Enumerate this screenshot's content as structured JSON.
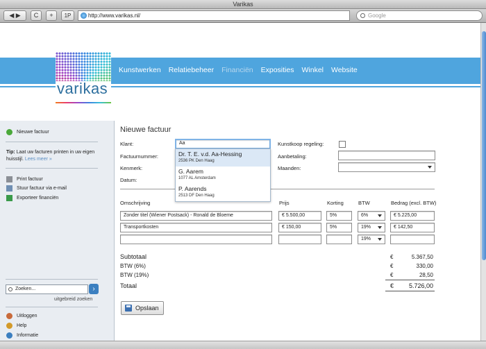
{
  "window": {
    "title": "Varikas"
  },
  "browser": {
    "url": "http://www.varikas.nl/",
    "search_placeholder": "Google",
    "reload_glyph": "C",
    "add_glyph": "+",
    "onepass_label": "1P"
  },
  "logo": {
    "text": "varikas"
  },
  "nav": {
    "items": [
      "Kunstwerken",
      "Relatiebeheer",
      "Financiën",
      "Exposities",
      "Winkel",
      "Website"
    ],
    "active": "Financiën"
  },
  "sidebar": {
    "new_invoice": "Nieuwe factuur",
    "tip_bold": "Tip:",
    "tip_text": " Laat uw facturen printen in uw eigen huisstijl. ",
    "tip_link": "Lees meer »",
    "actions": [
      "Print factuur",
      "Stuur factuur via e-mail",
      "Exporteer financiën"
    ],
    "search_placeholder": "Zoeken...",
    "advanced_search": "uitgebreid zoeken",
    "footer": [
      "Uitloggen",
      "Help",
      "Informatie"
    ]
  },
  "form": {
    "title": "Nieuwe factuur",
    "labels": {
      "klant": "Klant:",
      "factuurnummer": "Factuurnummer:",
      "kenmerk": "Kenmerk:",
      "datum": "Datum:",
      "kunstkoop": "Kunstkoop regeling:",
      "aanbetaling": "Aanbetaling:",
      "maanden": "Maanden:"
    },
    "klant_value": "Aa",
    "kunstkoop_checked": false,
    "autocomplete": [
      {
        "name": "Dr. T. E. v.d. Aa-Hessing",
        "address": "2536 PK  Den Haag",
        "highlighted": true
      },
      {
        "name": "G. Aarem",
        "address": "1077 AL  Amsterdam",
        "highlighted": false
      },
      {
        "name": "P. Aarends",
        "address": "2513 DF  Den Haag",
        "highlighted": false
      }
    ]
  },
  "table": {
    "headers": [
      "Omschrijving",
      "Prijs",
      "Korting",
      "BTW",
      "Bedrag (excl. BTW)"
    ],
    "rows": [
      {
        "desc": "Zonder titel (Wiener Postsack) - Ronald de Bloeme",
        "price": "€ 5.500,00",
        "discount": "5%",
        "vat": "6%",
        "amount": "€ 5.225,00"
      },
      {
        "desc": "Transportkosten",
        "price": "€ 150,00",
        "discount": "5%",
        "vat": "19%",
        "amount": "€ 142,50"
      },
      {
        "desc": "",
        "price": "",
        "discount": "",
        "vat": "19%",
        "amount": ""
      }
    ]
  },
  "totals": {
    "currency": "€",
    "subtotal_label": "Subtotaal",
    "subtotal": "5.367,50",
    "vat6_label": "BTW (6%)",
    "vat6": "330,00",
    "vat19_label": "BTW (19%)",
    "vat19": "28,50",
    "total_label": "Totaal",
    "total": "5.726,00"
  },
  "save_label": "Opslaan",
  "colors": {
    "brand_blue": "#4fa5de",
    "logo_text": "#2d6f9e",
    "highlight": "#dbe8f6"
  }
}
